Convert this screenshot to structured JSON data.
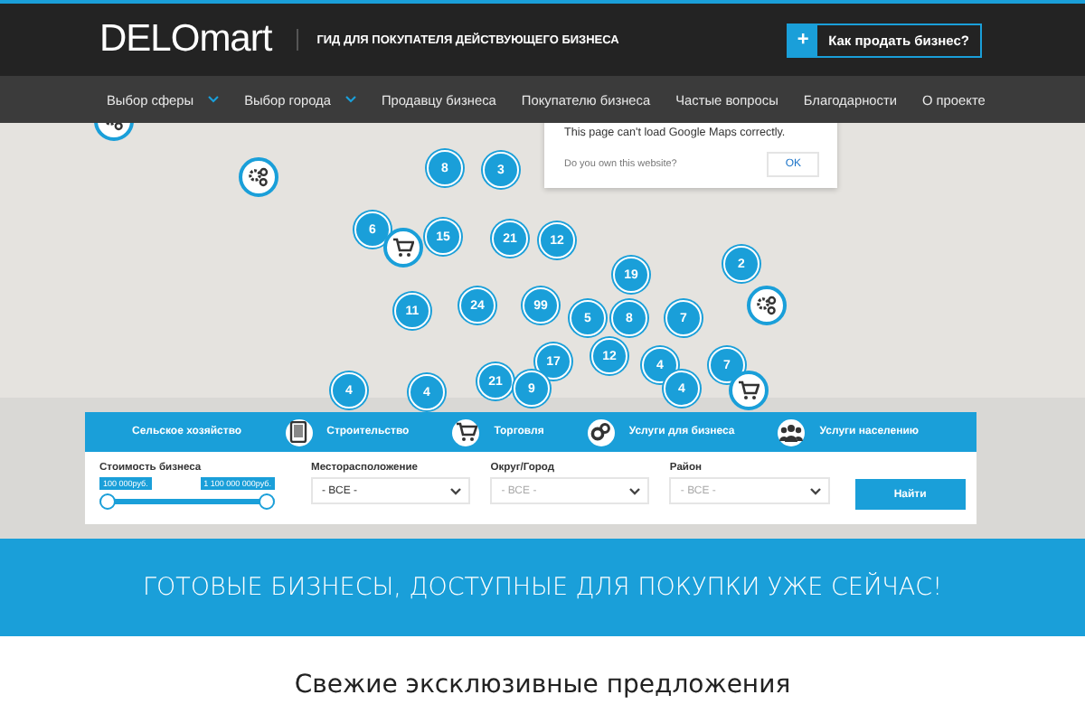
{
  "header": {
    "logo": "DELO**mart**",
    "tagline": "ГИД ДЛЯ ПОКУПАТЕЛЯ ДЕЙСТВУЮЩЕГО БИЗНЕСА",
    "sell_button": {
      "icon": "+",
      "label": "Как продать бизнес?"
    }
  },
  "nav": [
    {
      "label": "Выбор сферы",
      "dropdown": true
    },
    {
      "label": "Выбор города",
      "dropdown": true
    },
    {
      "label": "Продавцу бизнеса",
      "dropdown": false
    },
    {
      "label": "Покупателю бизнеса",
      "dropdown": false
    },
    {
      "label": "Частые вопросы",
      "dropdown": false
    },
    {
      "label": "Благодарности",
      "dropdown": false
    },
    {
      "label": "О проекте",
      "dropdown": false
    }
  ],
  "map": {
    "error_popup": {
      "message": "This page can't load Google Maps correctly.",
      "question": "Do you own this website?",
      "button": "OK"
    },
    "markers": [
      {
        "kind": "gear"
      },
      {
        "kind": "gear"
      },
      {
        "kind": "count",
        "label": "8"
      },
      {
        "kind": "count",
        "label": "3"
      },
      {
        "kind": "count",
        "label": "6"
      },
      {
        "kind": "cart"
      },
      {
        "kind": "count",
        "label": "15"
      },
      {
        "kind": "count",
        "label": "21"
      },
      {
        "kind": "count",
        "label": "12"
      },
      {
        "kind": "count",
        "label": "19"
      },
      {
        "kind": "count",
        "label": "2"
      },
      {
        "kind": "gear"
      },
      {
        "kind": "count",
        "label": "11"
      },
      {
        "kind": "count",
        "label": "24"
      },
      {
        "kind": "count",
        "label": "99"
      },
      {
        "kind": "count",
        "label": "5"
      },
      {
        "kind": "count",
        "label": "8"
      },
      {
        "kind": "count",
        "label": "7"
      },
      {
        "kind": "count",
        "label": "17"
      },
      {
        "kind": "count",
        "label": "12"
      },
      {
        "kind": "count",
        "label": "4"
      },
      {
        "kind": "count",
        "label": "7"
      },
      {
        "kind": "count",
        "label": "21"
      },
      {
        "kind": "count",
        "label": "4"
      },
      {
        "kind": "count",
        "label": "4"
      },
      {
        "kind": "count",
        "label": "9"
      },
      {
        "kind": "count",
        "label": "4"
      },
      {
        "kind": "cart"
      }
    ]
  },
  "search": {
    "categories": [
      {
        "label": "Сельское хозяйство",
        "kind": "plain"
      },
      {
        "label": "Строительство",
        "kind": "tablet"
      },
      {
        "label": "Торговля",
        "kind": "cart"
      },
      {
        "label": "Услуги для бизнеса",
        "kind": "gears"
      },
      {
        "label": "Услуги населению",
        "kind": "people"
      }
    ],
    "price": {
      "label": "Стоимость бизнеса",
      "min": "100 000руб.",
      "max": "1 100 000 000руб.",
      "level": 1
    },
    "selects": [
      {
        "label": "Месторасположение",
        "value": "- ВСЕ -",
        "disabled": false
      },
      {
        "label": "Округ/Город",
        "value": "- ВСЕ -",
        "disabled": true
      },
      {
        "label": "Район",
        "value": "- ВСЕ -",
        "disabled": true
      }
    ],
    "button": "Найти"
  },
  "banner": "ГОТОВЫЕ БИЗНЕСЫ, ДОСТУПНЫЕ ДЛЯ ПОКУПКИ УЖЕ СЕЙЧАС!",
  "section_title": "Свежие эксклюзивные предложения"
}
